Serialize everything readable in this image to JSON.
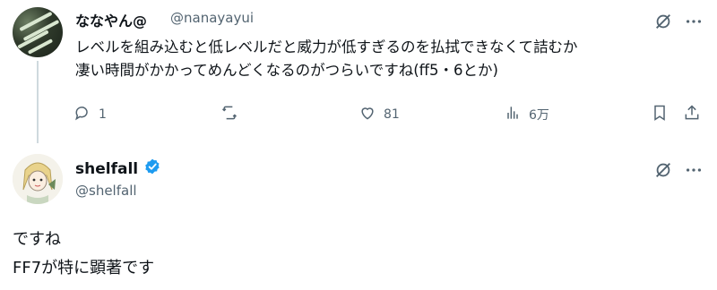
{
  "parent_tweet": {
    "display_name": "ななやん@",
    "handle": "@nanayayui",
    "text_lines": [
      "レベルを組み込むと低レベルだと威力が低すぎるのを払拭できなくて詰むか",
      "凄い時間がかかってめんどくなるのがつらいですね(ff5・6とか)"
    ],
    "actions": {
      "reply_count": "1",
      "like_count": "81",
      "view_count": "6万"
    }
  },
  "reply_tweet": {
    "display_name": "shelfall",
    "handle": "@shelfall",
    "text_lines": [
      "ですね",
      "FF7が特に顕著です"
    ]
  },
  "colors": {
    "verified": "#1d9bf0",
    "muted": "#536471",
    "text": "#0f1419",
    "thread_line": "#cfd9de"
  },
  "icons": [
    "grok-icon",
    "more-icon",
    "reply-icon",
    "retweet-icon",
    "like-icon",
    "views-icon",
    "bookmark-icon",
    "share-icon",
    "verified-badge-icon"
  ]
}
